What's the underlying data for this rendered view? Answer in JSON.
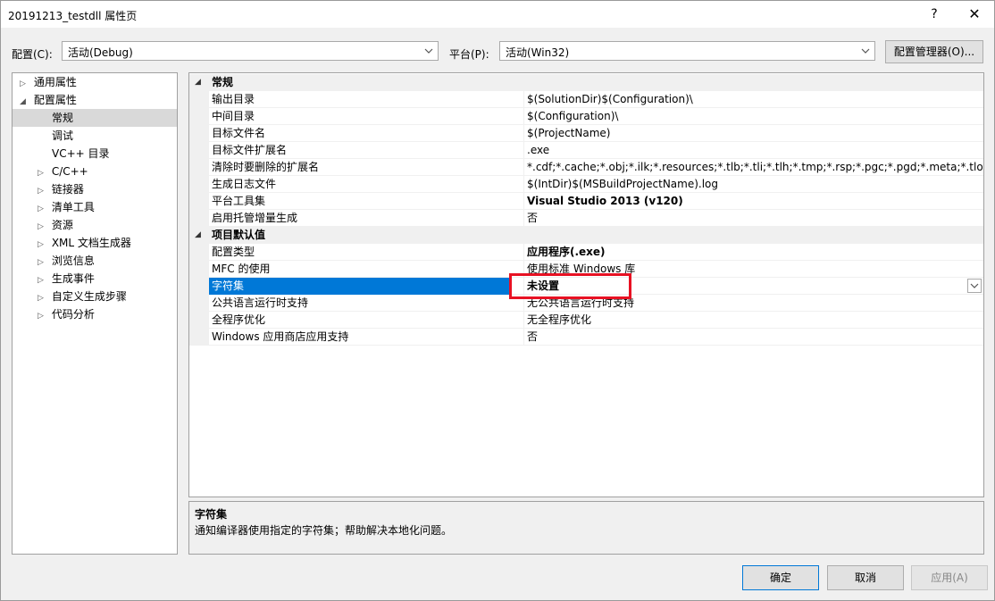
{
  "window": {
    "title": "20191213_testdll 属性页",
    "help": "?",
    "close": "✕"
  },
  "config": {
    "config_label": "配置(C):",
    "config_value": "活动(Debug)",
    "platform_label": "平台(P):",
    "platform_value": "活动(Win32)",
    "manager_button": "配置管理器(O)..."
  },
  "tree": {
    "items": [
      {
        "label": "通用属性",
        "twisty": "▷"
      },
      {
        "label": "配置属性",
        "twisty": "◢"
      },
      {
        "label": "常规",
        "twisty": ""
      },
      {
        "label": "调试",
        "twisty": ""
      },
      {
        "label": "VC++ 目录",
        "twisty": ""
      },
      {
        "label": "C/C++",
        "twisty": "▷"
      },
      {
        "label": "链接器",
        "twisty": "▷"
      },
      {
        "label": "清单工具",
        "twisty": "▷"
      },
      {
        "label": "资源",
        "twisty": "▷"
      },
      {
        "label": "XML 文档生成器",
        "twisty": "▷"
      },
      {
        "label": "浏览信息",
        "twisty": "▷"
      },
      {
        "label": "生成事件",
        "twisty": "▷"
      },
      {
        "label": "自定义生成步骤",
        "twisty": "▷"
      },
      {
        "label": "代码分析",
        "twisty": "▷"
      }
    ]
  },
  "grid": {
    "cat1": "常规",
    "cat2": "项目默认值",
    "rows": [
      {
        "name": "输出目录",
        "value": "$(SolutionDir)$(Configuration)\\"
      },
      {
        "name": "中间目录",
        "value": "$(Configuration)\\"
      },
      {
        "name": "目标文件名",
        "value": "$(ProjectName)"
      },
      {
        "name": "目标文件扩展名",
        "value": ".exe"
      },
      {
        "name": "清除时要删除的扩展名",
        "value": "*.cdf;*.cache;*.obj;*.ilk;*.resources;*.tlb;*.tli;*.tlh;*.tmp;*.rsp;*.pgc;*.pgd;*.meta;*.tlog;*.manifest"
      },
      {
        "name": "生成日志文件",
        "value": "$(IntDir)$(MSBuildProjectName).log"
      },
      {
        "name": "平台工具集",
        "value": "Visual Studio 2013 (v120)"
      },
      {
        "name": "启用托管增量生成",
        "value": "否"
      },
      {
        "name": "配置类型",
        "value": "应用程序(.exe)"
      },
      {
        "name": "MFC 的使用",
        "value": "使用标准 Windows 库"
      },
      {
        "name": "字符集",
        "value": "未设置"
      },
      {
        "name": "公共语言运行时支持",
        "value": "无公共语言运行时支持"
      },
      {
        "name": "全程序优化",
        "value": "无全程序优化"
      },
      {
        "name": "Windows 应用商店应用支持",
        "value": "否"
      }
    ]
  },
  "description": {
    "title": "字符集",
    "text": "通知编译器使用指定的字符集；帮助解决本地化问题。"
  },
  "buttons": {
    "ok": "确定",
    "cancel": "取消",
    "apply": "应用(A)"
  }
}
